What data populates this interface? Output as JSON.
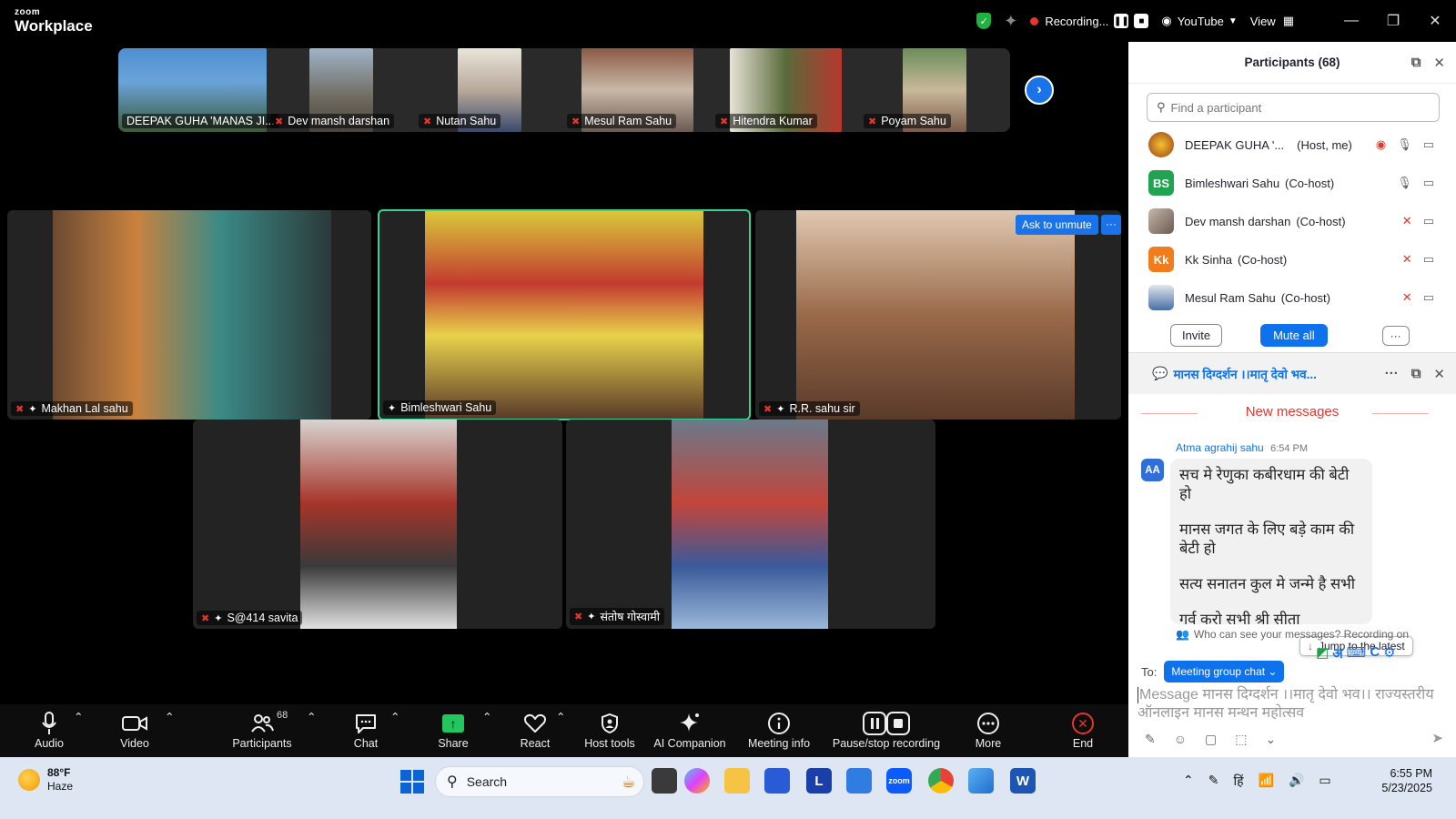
{
  "titlebar": {
    "brand_small": "zoom",
    "brand_big": "Workplace",
    "recording_label": "Recording...",
    "stream_label": "YouTube",
    "view_label": "View",
    "minimize_glyph": "—",
    "restore_glyph": "❐",
    "close_glyph": "✕"
  },
  "strip": {
    "thumbs": [
      {
        "name": "DEEPAK GUHA 'MANAS JI...",
        "muted": false
      },
      {
        "name": "Dev mansh darshan",
        "muted": true
      },
      {
        "name": "Nutan Sahu",
        "muted": true
      },
      {
        "name": "Mesul Ram Sahu",
        "muted": true
      },
      {
        "name": "Hitendra Kumar",
        "muted": true
      },
      {
        "name": "Poyam Sahu",
        "muted": true
      }
    ]
  },
  "gallery": {
    "tiles": [
      {
        "name": "Makhan Lal sahu"
      },
      {
        "name": "Bimleshwari Sahu"
      },
      {
        "name": "R.R. sahu sir"
      },
      {
        "name": "S@414 savita"
      },
      {
        "name": "संतोष गोस्वामी"
      }
    ],
    "ask_unmute": "Ask to unmute",
    "more_glyph": "···"
  },
  "toolbar": {
    "audio": "Audio",
    "video": "Video",
    "participants": "Participants",
    "participants_count": "68",
    "chat": "Chat",
    "share": "Share",
    "react": "React",
    "host_tools": "Host tools",
    "ai_companion": "AI Companion",
    "meeting_info": "Meeting info",
    "pause_stop": "Pause/stop recording",
    "more": "More",
    "end": "End"
  },
  "participants_panel": {
    "title": "Participants (68)",
    "search_placeholder": "Find a participant",
    "rows": [
      {
        "name": "DEEPAK GUHA '...",
        "role": "(Host, me)",
        "initials": "",
        "color": "#b5651d"
      },
      {
        "name": "Bimleshwari Sahu",
        "role": "(Co-host)",
        "initials": "BS",
        "color": "#22a352"
      },
      {
        "name": "Dev mansh darshan",
        "role": "(Co-host)",
        "initials": "",
        "color": "#8a7f7a"
      },
      {
        "name": "Kk Sinha",
        "role": "(Co-host)",
        "initials": "Kk",
        "color": "#f07c1b"
      },
      {
        "name": "Mesul Ram Sahu",
        "role": "(Co-host)",
        "initials": "",
        "color": "#4a6fa5"
      }
    ],
    "invite": "Invite",
    "mute_all": "Mute all",
    "more": "···"
  },
  "chat_panel": {
    "title": "मानस दिग्दर्शन ।।मातृ देवो भव...",
    "new_messages": "New messages",
    "sender": "Atma agrahij sahu",
    "time": "6:54 PM",
    "sender_initials": "AA",
    "message_lines": [
      "सच मे रेणुका कबीरधाम की बेटी हो",
      "मानस जगत के लिए बड़े काम की बेटी हो",
      "सत्य सनातन कुल मे जन्मे है सभी",
      "गर्व करो सभी श्री सीता"
    ],
    "jump_latest": "Jump to the latest",
    "who_can_see": "Who can see your messages? Recording on",
    "to_label": "To:",
    "to_target": "Meeting group chat",
    "input_placeholder": "Message मानस दिग्दर्शन ।।मातृ देवो भव।। राज्यस्तरीय ऑनलाइन मानस मन्थन महोत्सव"
  },
  "taskbar": {
    "temp": "88°F",
    "condition": "Haze",
    "search_label": "Search",
    "language": "हिं",
    "time": "6:55 PM",
    "date": "5/23/2025"
  }
}
